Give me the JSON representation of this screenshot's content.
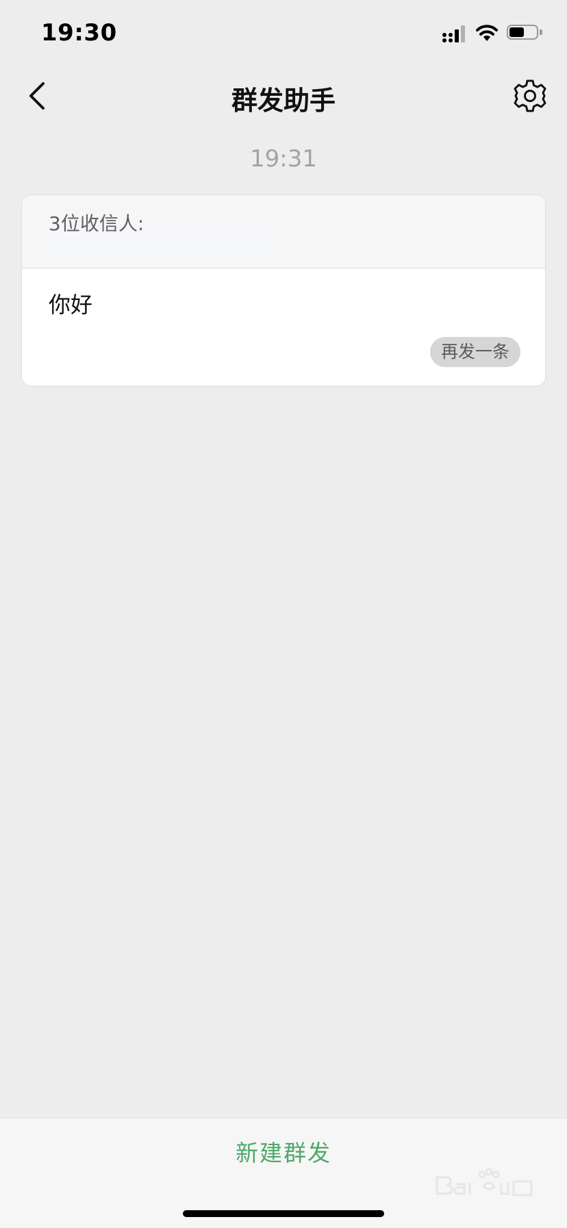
{
  "status_bar": {
    "time": "19:30",
    "battery_level": 0.55
  },
  "nav": {
    "title": "群发助手",
    "back_icon": "chevron-left-icon",
    "settings_icon": "gear-icon"
  },
  "timestamp": "19:31",
  "message_card": {
    "recipient_label": "3位收信人:",
    "message_text": "你好",
    "resend_label": "再发一条"
  },
  "bottom": {
    "new_broadcast_label": "新建群发"
  },
  "colors": {
    "background": "#ededed",
    "accent_green": "#4fa86a",
    "timestamp_gray": "#a3a3a3"
  }
}
